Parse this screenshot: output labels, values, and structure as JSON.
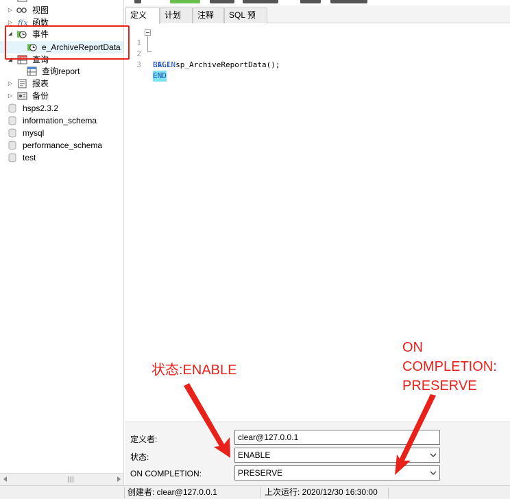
{
  "tree": {
    "items": [
      {
        "label": "视图",
        "icon": "view-icon"
      },
      {
        "label": "函数",
        "icon": "function-icon"
      },
      {
        "label": "事件",
        "icon": "event-icon"
      },
      {
        "label": "e_ArchiveReportData",
        "icon": "event-item-icon"
      },
      {
        "label": "查询",
        "icon": "query-icon"
      },
      {
        "label": "查询report",
        "icon": "query-item-icon"
      },
      {
        "label": "报表",
        "icon": "report-icon"
      },
      {
        "label": "备份",
        "icon": "backup-icon"
      }
    ],
    "databases": [
      "hsps2.3.2",
      "information_schema",
      "mysql",
      "performance_schema",
      "test"
    ]
  },
  "tabs": [
    "定义",
    "计划",
    "注释",
    "SQL 预览"
  ],
  "editor": {
    "lines": [
      {
        "num": "1",
        "text": "BEGIN"
      },
      {
        "num": "2",
        "call": "CALL",
        "rest": " sp_ArchiveReportData();"
      },
      {
        "num": "3",
        "text": "END"
      }
    ]
  },
  "annotations": {
    "status": "状态:ENABLE",
    "completion_1": "ON",
    "completion_2": "COMPLETION:",
    "completion_3": "PRESERVE"
  },
  "form": {
    "definer_label": "定义者:",
    "definer_value": "clear@127.0.0.1",
    "status_label": "状态:",
    "status_value": "ENABLE",
    "completion_label": "ON COMPLETION:",
    "completion_value": "PRESERVE"
  },
  "status_bar": {
    "creator": "创建者: clear@127.0.0.1",
    "last_run": "上次运行: 2020/12/30 16:30:00"
  },
  "colors": {
    "annotation": "#e8211b",
    "keyword": "#1e50c8",
    "match_highlight": "#7de3ee"
  }
}
